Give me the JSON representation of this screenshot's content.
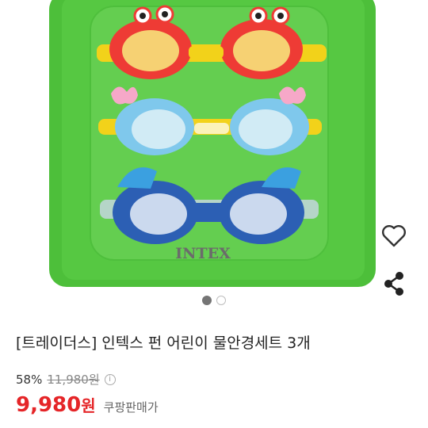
{
  "image": {
    "brand_text": "INTEX",
    "colors": {
      "board": "#4dbf3a",
      "board_dark": "#2e9a25",
      "red": "#ee3b35",
      "yellow": "#f2d21a",
      "blue": "#2c5fb4",
      "light_blue": "#7fc8ec"
    }
  },
  "actions": {
    "wishlist_icon": "heart-outline-icon",
    "share_icon": "share-icon"
  },
  "carousel": {
    "total": 2,
    "active_index": 0
  },
  "product": {
    "title": "[트레이더스] 인텍스 펀 어린이 물안경세트 3개",
    "discount": "58%",
    "original_price": "11,980원",
    "info_symbol": "i",
    "sale_price": "9,980",
    "sale_unit": "원",
    "sale_label": "쿠팡판매가"
  },
  "colors": {
    "accent": "#e52528",
    "muted": "#888888"
  }
}
